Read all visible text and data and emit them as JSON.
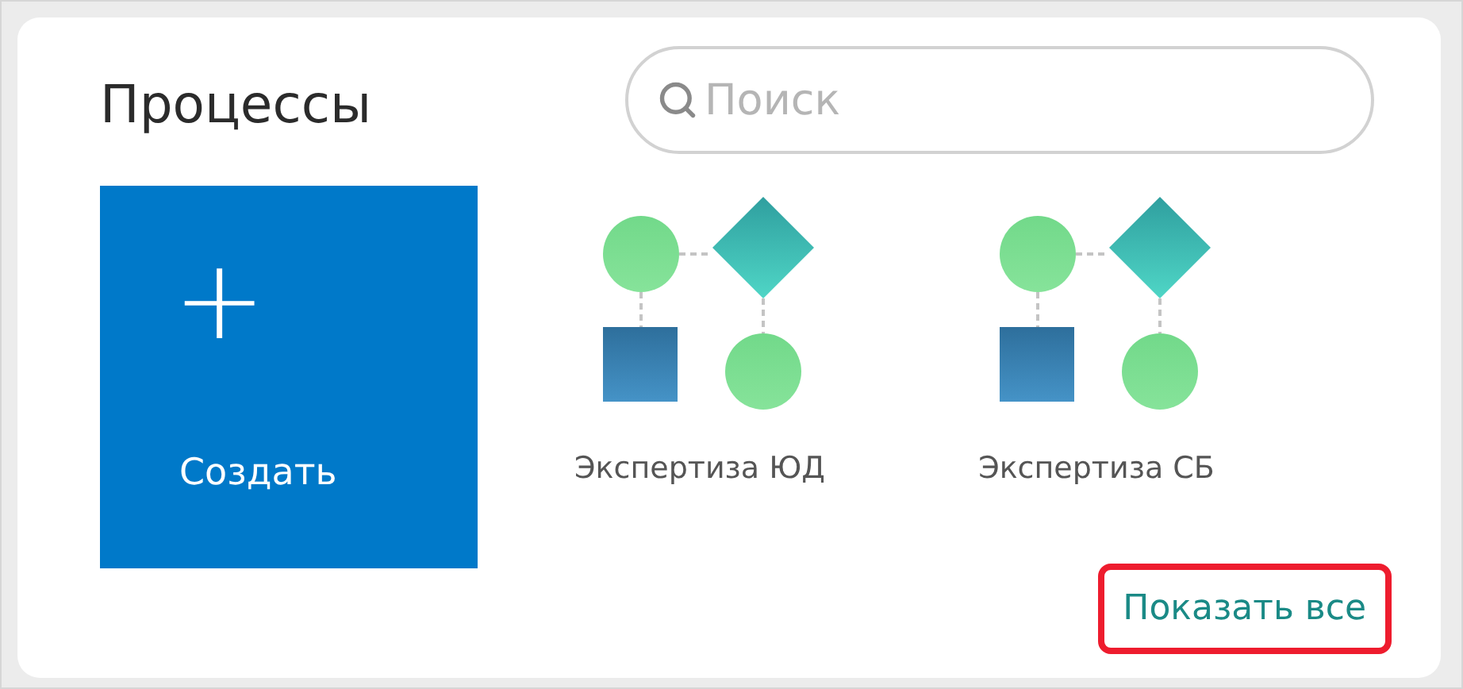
{
  "title": "Процессы",
  "search": {
    "placeholder": "Поиск"
  },
  "create_tile": {
    "icon": "+",
    "label": "Создать"
  },
  "processes": [
    {
      "label": "Экспертиза ЮД"
    },
    {
      "label": "Экспертиза СБ"
    }
  ],
  "show_all": {
    "label": "Показать все",
    "highlighted": true
  }
}
